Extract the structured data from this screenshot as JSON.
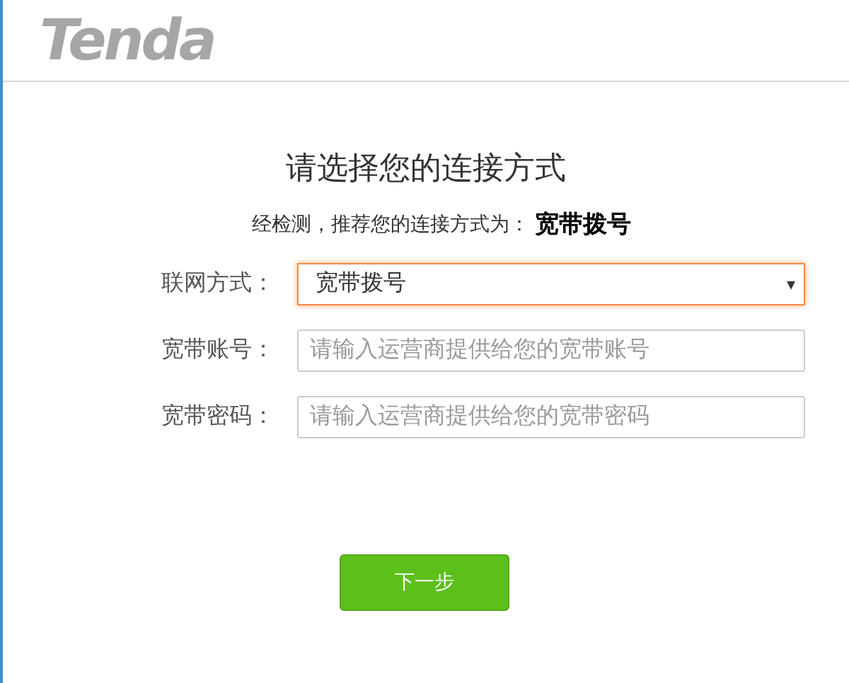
{
  "header": {
    "logo": "Tenda"
  },
  "title": "请选择您的连接方式",
  "recommendation": {
    "prefix": "经检测，推荐您的连接方式为：",
    "value": "宽带拨号"
  },
  "fields": [
    {
      "kind": "select",
      "label": "联网方式：",
      "value": "宽带拨号",
      "arrow": "▾"
    },
    {
      "kind": "input",
      "label": "宽带账号：",
      "placeholder": "请输入运营商提供给您的宽带账号"
    },
    {
      "kind": "input",
      "label": "宽带密码：",
      "placeholder": "请输入运营商提供给您的宽带密码"
    }
  ],
  "next_button": "下一步"
}
